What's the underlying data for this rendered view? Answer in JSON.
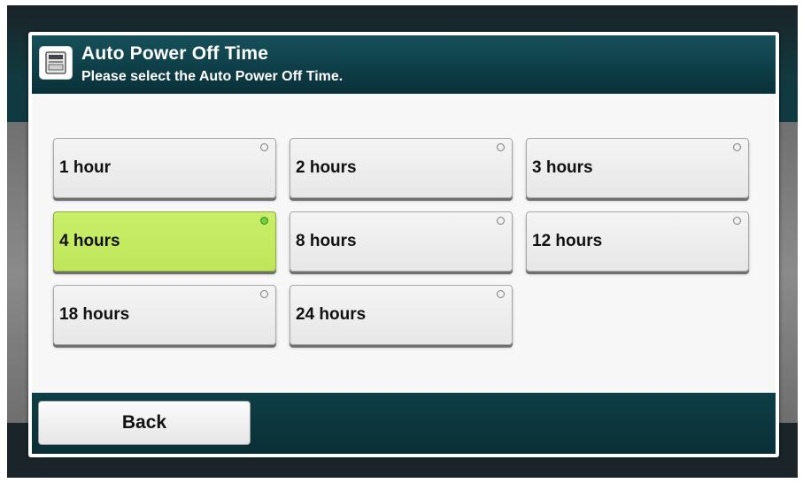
{
  "dialog": {
    "title": "Auto Power Off Time",
    "subtitle": "Please select the Auto Power Off Time.",
    "icon": "printer-icon"
  },
  "options": [
    {
      "label": "1 hour",
      "selected": false
    },
    {
      "label": "2 hours",
      "selected": false
    },
    {
      "label": "3 hours",
      "selected": false
    },
    {
      "label": "4 hours",
      "selected": true
    },
    {
      "label": "8 hours",
      "selected": false
    },
    {
      "label": "12 hours",
      "selected": false
    },
    {
      "label": "18 hours",
      "selected": false
    },
    {
      "label": "24 hours",
      "selected": false
    }
  ],
  "footer": {
    "back_label": "Back"
  },
  "colors": {
    "title_bar": "#0e3f48",
    "selected_option": "#c4ea62",
    "option": "#ececec"
  }
}
